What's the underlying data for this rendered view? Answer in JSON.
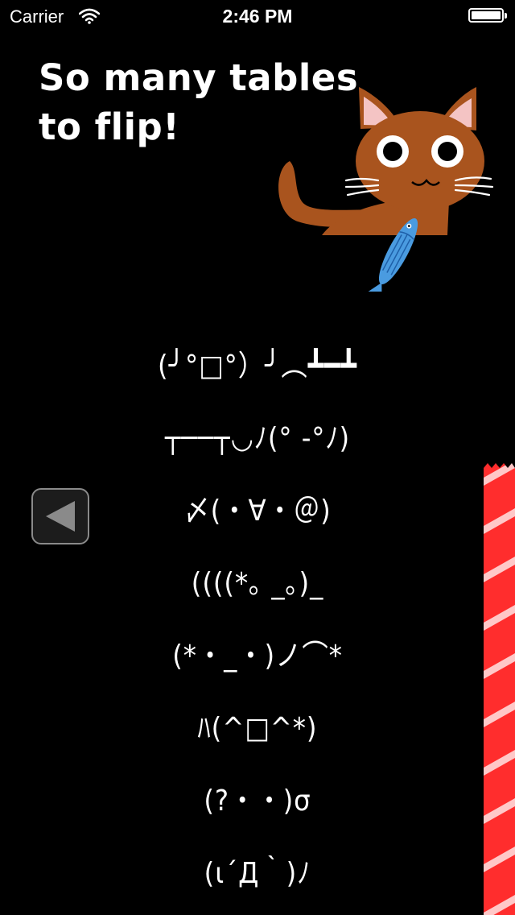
{
  "status_bar": {
    "carrier": "Carrier",
    "time": "2:46 PM"
  },
  "headline": "So many tables to flip!",
  "faces": [
    "(╯°□°）╯︵┻━┻",
    "┬──┬◡ﾉ(° -°ﾉ)",
    "〆(・∀・＠)",
    "((((*｡ _｡)_",
    "(*・_・)ノ⌒*",
    "ﾊ(^□^*)",
    "(?・・)σ",
    "(ι´Д｀)ﾉ"
  ],
  "colors": {
    "background": "#000000",
    "text": "#ffffff",
    "cat_body": "#a9541e",
    "cat_ear_inner": "#f4c4c4",
    "fish": "#4a9be0",
    "strip_red": "#ff2d2d",
    "strip_light": "#ffc8c8"
  },
  "icons": {
    "wifi": "wifi-icon",
    "battery": "battery-icon",
    "back": "left-triangle-icon"
  }
}
